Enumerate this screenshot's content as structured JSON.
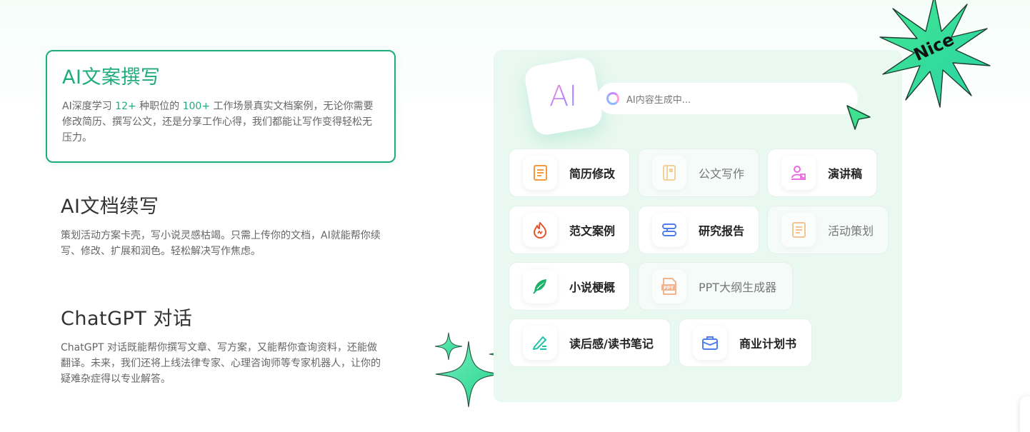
{
  "features": [
    {
      "title": "AI文案撰写",
      "desc_parts": [
        "AI深度学习 ",
        "12+",
        " 种职位的 ",
        "100+",
        " 工作场景真实文档案例，无论你需要修改简历、撰写公文，还是分享工作心得，我们都能让写作变得轻松无压力。"
      ],
      "active": true
    },
    {
      "title": "AI文档续写",
      "desc": "策划活动方案卡壳，写小说灵感枯竭。只需上传你的文档，AI就能帮你续写、修改、扩展和润色。轻松解决写作焦虑。",
      "active": false
    },
    {
      "title": "ChatGPT 对话",
      "desc": "ChatGPT 对话既能帮你撰写文章、写方案，又能帮你查询资料，还能做翻译。未来，我们还将上线法律专家、心理咨询师等专家机器人，让你的疑难杂症得以专业解答。",
      "active": false
    }
  ],
  "panel": {
    "logo_text": "AI",
    "generating_text": "AI内容生成中...",
    "badge_text": "Nice"
  },
  "tools": [
    {
      "label": "简历修改",
      "icon": "resume-icon",
      "dim": false
    },
    {
      "label": "公文写作",
      "icon": "document-icon",
      "dim": true
    },
    {
      "label": "演讲稿",
      "icon": "speech-icon",
      "dim": false
    },
    {
      "label": "范文案例",
      "icon": "flame-icon",
      "dim": false
    },
    {
      "label": "研究报告",
      "icon": "report-icon",
      "dim": false
    },
    {
      "label": "活动策划",
      "icon": "event-plan-icon",
      "dim": true
    },
    {
      "label": "小说梗概",
      "icon": "feather-icon",
      "dim": false
    },
    {
      "label": "PPT大纲生成器",
      "icon": "ppt-icon",
      "dim": true
    },
    {
      "label": "读后感/读书笔记",
      "icon": "pen-note-icon",
      "dim": false
    },
    {
      "label": "商业计划书",
      "icon": "briefcase-icon",
      "dim": false
    }
  ],
  "colors": {
    "accent": "#1eab7e",
    "panel_bg": "#e9f8f1",
    "badge_green": "#3fe78f"
  }
}
